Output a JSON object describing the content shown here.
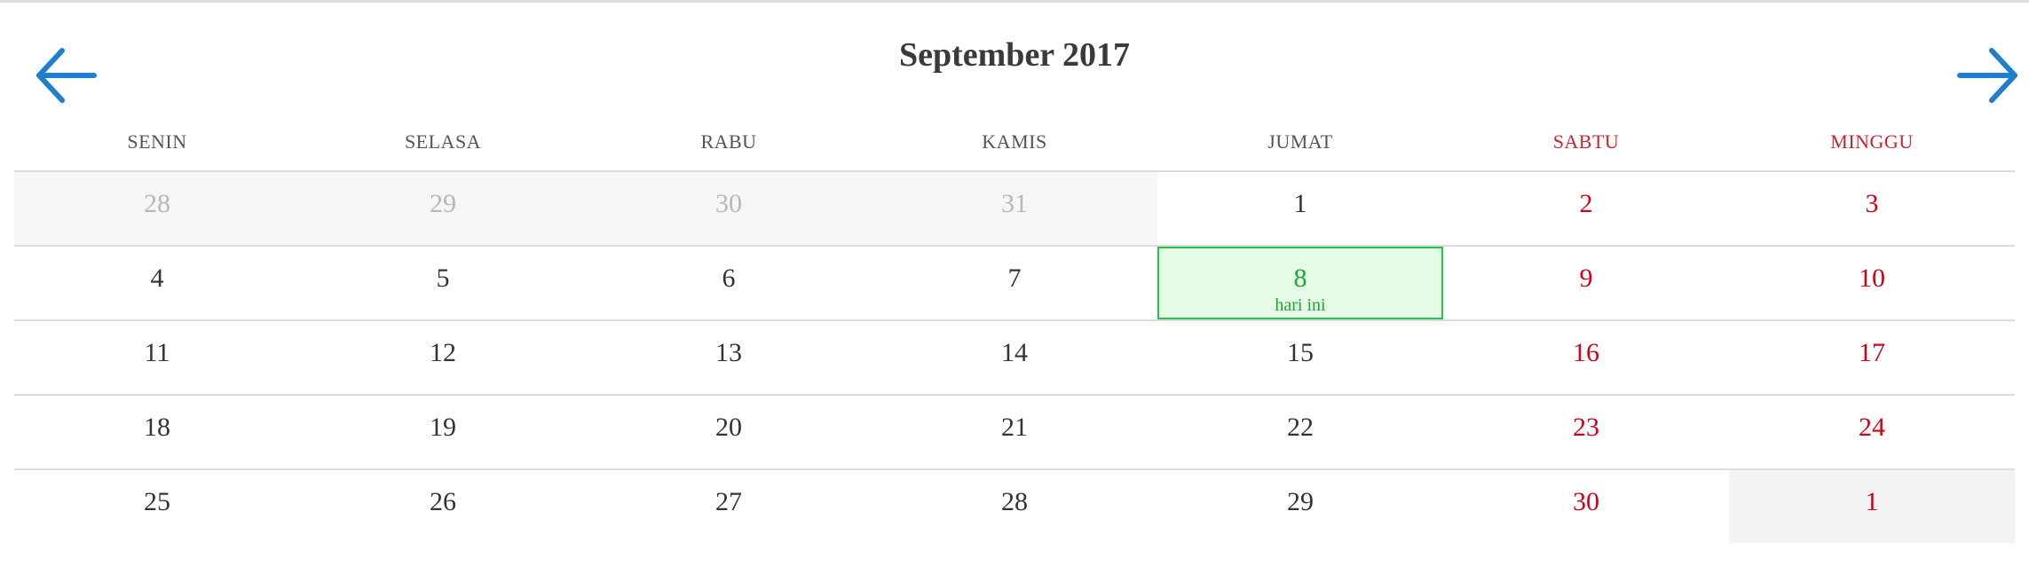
{
  "calendar": {
    "title": "September 2017",
    "prev_icon": "arrow-left-icon",
    "next_icon": "arrow-right-icon",
    "accent_color": "#1f7fcf",
    "weekend_color": "#d0021b",
    "today_color": "#1aa83a",
    "today_label": "hari ini",
    "weekdays": [
      {
        "label": "SENIN",
        "weekend": false
      },
      {
        "label": "SELASA",
        "weekend": false
      },
      {
        "label": "RABU",
        "weekend": false
      },
      {
        "label": "KAMIS",
        "weekend": false
      },
      {
        "label": "JUMAT",
        "weekend": false
      },
      {
        "label": "SABTU",
        "weekend": true
      },
      {
        "label": "MINGGU",
        "weekend": true
      }
    ],
    "weeks": [
      [
        {
          "day": "28",
          "outside": true
        },
        {
          "day": "29",
          "outside": true
        },
        {
          "day": "30",
          "outside": true
        },
        {
          "day": "31",
          "outside": true
        },
        {
          "day": "1"
        },
        {
          "day": "2",
          "weekend": true
        },
        {
          "day": "3",
          "weekend": true
        }
      ],
      [
        {
          "day": "4"
        },
        {
          "day": "5"
        },
        {
          "day": "6"
        },
        {
          "day": "7"
        },
        {
          "day": "8",
          "today": true
        },
        {
          "day": "9",
          "weekend": true
        },
        {
          "day": "10",
          "weekend": true
        }
      ],
      [
        {
          "day": "11"
        },
        {
          "day": "12"
        },
        {
          "day": "13"
        },
        {
          "day": "14"
        },
        {
          "day": "15"
        },
        {
          "day": "16",
          "weekend": true
        },
        {
          "day": "17",
          "weekend": true
        }
      ],
      [
        {
          "day": "18"
        },
        {
          "day": "19"
        },
        {
          "day": "20"
        },
        {
          "day": "21"
        },
        {
          "day": "22"
        },
        {
          "day": "23",
          "weekend": true
        },
        {
          "day": "24",
          "weekend": true
        }
      ],
      [
        {
          "day": "25"
        },
        {
          "day": "26"
        },
        {
          "day": "27"
        },
        {
          "day": "28"
        },
        {
          "day": "29"
        },
        {
          "day": "30",
          "weekend": true
        },
        {
          "day": "1",
          "weekend": true,
          "outside": true
        }
      ]
    ]
  }
}
